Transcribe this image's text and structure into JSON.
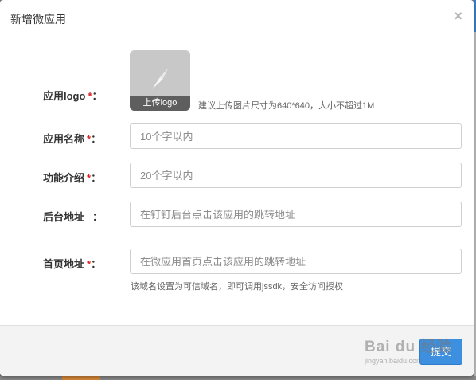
{
  "dialog": {
    "title": "新增微应用",
    "close_glyph": "×"
  },
  "form": {
    "logo": {
      "label": "应用logo",
      "required_mark": "*",
      "colon": "：",
      "upload_caption": "上传logo",
      "upload_icon": "compass-icon",
      "hint": "建议上传图片尺寸为640*640，大小不超过1M"
    },
    "name": {
      "label": "应用名称",
      "required_mark": "*",
      "colon": "：",
      "placeholder": "10个字以内"
    },
    "intro": {
      "label": "功能介绍",
      "required_mark": "*",
      "colon": "：",
      "placeholder": "20个字以内"
    },
    "admin_url": {
      "label": "后台地址",
      "colon": "：",
      "placeholder": "在钉钉后台点击该应用的跳转地址"
    },
    "home_url": {
      "label": "首页地址",
      "required_mark": "*",
      "colon": "：",
      "placeholder": "在微应用首页点击该应用的跳转地址",
      "hint": "该域名设置为可信域名，即可调用jssdk，安全访问授权"
    }
  },
  "footer": {
    "submit_label": "提交"
  },
  "watermark": {
    "main": "Bai du 经验",
    "sub": "jingyan.baidu.com"
  },
  "colors": {
    "required": "#e02020",
    "primary": "#3d8fe0",
    "upload_bg": "#c8c8c8"
  }
}
